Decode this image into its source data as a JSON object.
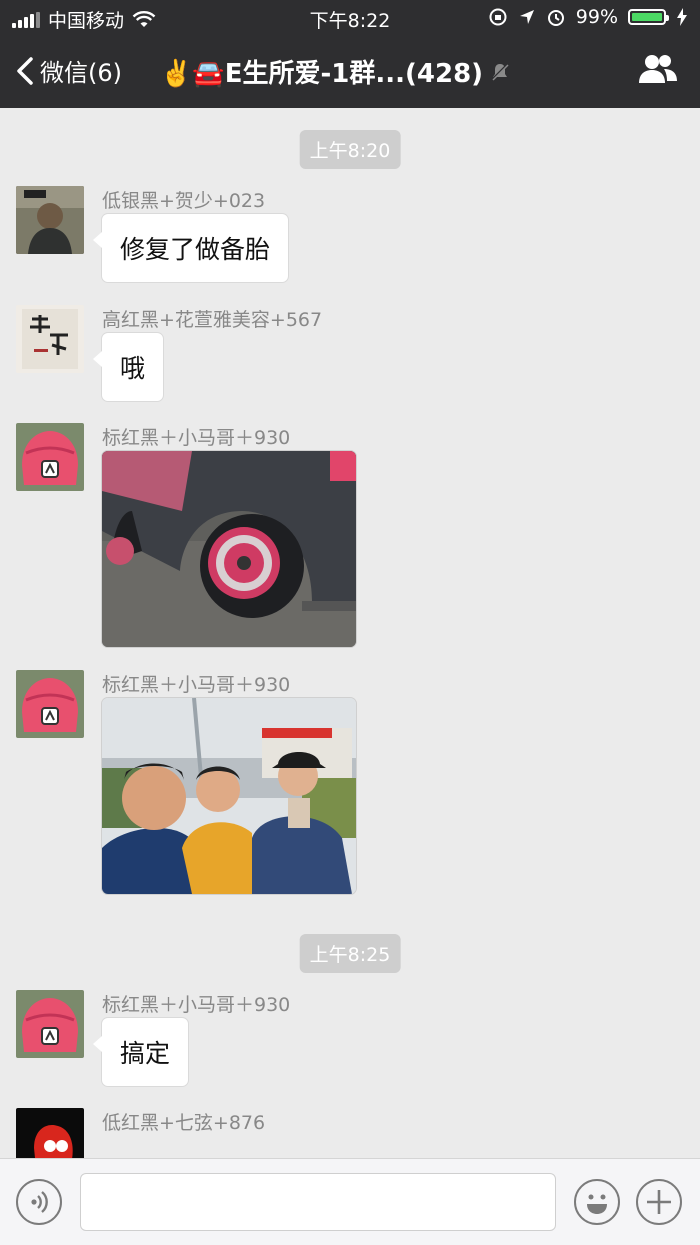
{
  "status_bar": {
    "carrier": "中国移动",
    "time": "下午8:22",
    "battery_pct": "99%",
    "battery_level": 0.99,
    "battery_color": "#4cd964"
  },
  "nav": {
    "back_label": "微信(6)",
    "title": "✌️🚘E生所爱-1群...(428)",
    "mute_icon": "bell-off-icon",
    "members_icon": "group-members-icon"
  },
  "chat": {
    "time_dividers": [
      "上午8:20",
      "上午8:25"
    ],
    "messages": [
      {
        "sender": "低银黑+贺少+023",
        "type": "text",
        "text": "修复了做备胎"
      },
      {
        "sender": "高红黑+花萱雅美容+567",
        "type": "text",
        "text": "哦"
      },
      {
        "sender": "标红黑＋小马哥＋930",
        "type": "image",
        "image": "car-wheel-photo"
      },
      {
        "sender": "标红黑＋小马哥＋930",
        "type": "image",
        "image": "group-selfie-photo"
      },
      {
        "sender": "标红黑＋小马哥＋930",
        "type": "text",
        "text": "搞定"
      },
      {
        "sender": "低红黑+七弦+876",
        "type": "text",
        "text": ""
      }
    ]
  },
  "input_bar": {
    "voice_icon": "voice-icon",
    "emoji_icon": "emoji-icon",
    "plus_icon": "plus-icon",
    "input_value": ""
  }
}
